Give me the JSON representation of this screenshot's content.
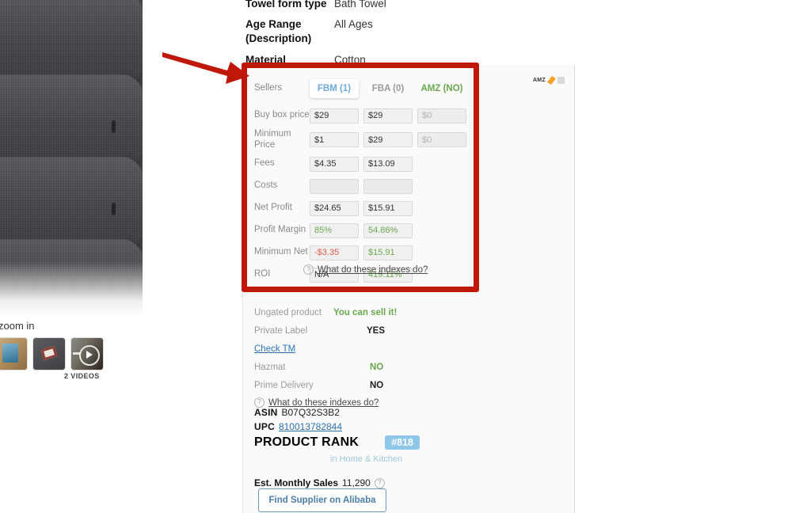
{
  "product_attributes": [
    {
      "key": "Towel form type",
      "value": "Bath Towel"
    },
    {
      "key": "Age Range (Description)",
      "value": "All Ages"
    },
    {
      "key": "Material",
      "value": "Cotton"
    }
  ],
  "gallery": {
    "zoom_label": "zoom in",
    "videos_label": "2 VIDEOS",
    "thumbnails": [
      "lifestyle-thumbnail",
      "folded-towel-thumbnail",
      "video-thumbnail"
    ]
  },
  "extension_panel": {
    "brand": "AMZ",
    "calculator": {
      "sellers_label": "Sellers",
      "tabs": [
        {
          "label": "FBM (1)",
          "state": "selected",
          "color": "#6fa8dc"
        },
        {
          "label": "FBA (0)",
          "state": "inactive",
          "color": "#9a9a9a"
        },
        {
          "label": "AMZ (NO)",
          "state": "inactive",
          "color": "#6aa84f"
        }
      ],
      "rows": [
        {
          "label": "Buy box price",
          "cells": [
            {
              "value": "$29",
              "style": "plain"
            },
            {
              "value": "$29",
              "style": "plain"
            },
            {
              "value": "$0",
              "style": "muted"
            }
          ]
        },
        {
          "label": "Minimum Price",
          "cells": [
            {
              "value": "$1",
              "style": "plain"
            },
            {
              "value": "$29",
              "style": "plain"
            },
            {
              "value": "$0",
              "style": "muted"
            }
          ]
        },
        {
          "label": "Fees",
          "cells": [
            {
              "value": "$4.35",
              "style": "plain"
            },
            {
              "value": "$13.09",
              "style": "plain"
            },
            {
              "value": "",
              "style": "none"
            }
          ]
        },
        {
          "label": "Costs",
          "cells": [
            {
              "value": "",
              "style": "empty"
            },
            {
              "value": "",
              "style": "empty"
            },
            {
              "value": "",
              "style": "none"
            }
          ]
        },
        {
          "label": "Net Profit",
          "cells": [
            {
              "value": "$24.65",
              "style": "plain"
            },
            {
              "value": "$15.91",
              "style": "plain"
            },
            {
              "value": "",
              "style": "none"
            }
          ]
        },
        {
          "label": "Profit Margin",
          "cells": [
            {
              "value": "85%",
              "style": "green"
            },
            {
              "value": "54.86%",
              "style": "green"
            },
            {
              "value": "",
              "style": "none"
            }
          ]
        },
        {
          "label": "Minimum Net",
          "cells": [
            {
              "value": "-$3.35",
              "style": "red"
            },
            {
              "value": "$15.91",
              "style": "green"
            },
            {
              "value": "",
              "style": "none"
            }
          ]
        },
        {
          "label": "ROI",
          "cells": [
            {
              "value": "N/A",
              "style": "plain"
            },
            {
              "value": "419.11%",
              "style": "green"
            },
            {
              "value": "",
              "style": "none"
            }
          ]
        }
      ],
      "help_link": "What do these indexes do?",
      "help_icon": "question-mark-icon"
    },
    "indexes": {
      "rows": [
        {
          "key": "Ungated product",
          "value": "You can sell it!",
          "tone": "green"
        },
        {
          "key": "Private Label",
          "value": "YES",
          "tone": "dark"
        },
        {
          "key": "Hazmat",
          "value": "NO",
          "tone": "green"
        },
        {
          "key": "Prime Delivery",
          "value": "NO",
          "tone": "dark"
        }
      ],
      "check_tm_link": "Check TM",
      "help_link": "What do these indexes do?"
    },
    "identifiers": {
      "asin_label": "ASIN",
      "asin_value": "B07Q32S3B2",
      "upc_label": "UPC",
      "upc_value": "810013782844",
      "rank_label": "PRODUCT RANK",
      "rank_badge": "#818",
      "rank_category": "in Home & Kitchen",
      "sales_label": "Est. Monthly Sales",
      "sales_value": "11,290"
    },
    "alibaba_button": "Find Supplier on Alibaba"
  },
  "annotation": {
    "highlight_color": "#c0170b",
    "arrow": "red-arrow-pointing-right"
  }
}
